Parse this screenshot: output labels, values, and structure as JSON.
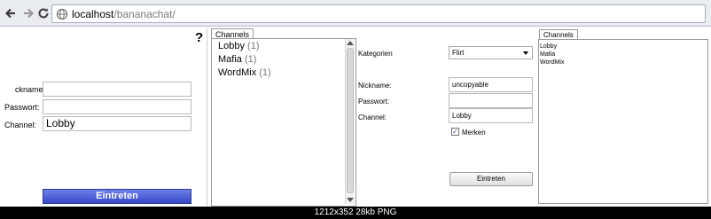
{
  "browser": {
    "url_host": "localhost",
    "url_path": "/bananachat/",
    "icons": [
      "back-icon",
      "forward-icon",
      "globe-icon"
    ]
  },
  "login": {
    "help": "?",
    "nickname_label": "ckname:",
    "password_label": "Passwort:",
    "channel_label": "Channel:",
    "nickname_value": "",
    "password_value": "",
    "channel_value": "Lobby",
    "submit_label": "Eintreten",
    "submit_color": "#3f52d2"
  },
  "channels_panel": {
    "tab_label": "Channels",
    "items": [
      {
        "name": "Lobby",
        "count": "(1)"
      },
      {
        "name": "Mafia",
        "count": "(1)"
      },
      {
        "name": "WordMix",
        "count": "(1)"
      }
    ]
  },
  "form2": {
    "kategorien_label": "Kategorien",
    "kategorien_value": "Flirt",
    "nickname_label": "Nickname:",
    "nickname_value": "uncopyable",
    "password_label": "Passwort:",
    "password_value": "",
    "channel_label": "Channel:",
    "channel_value": "Lobby",
    "remember_label": "Merken",
    "remember_checked": true,
    "submit_label": "Eintreten"
  },
  "channels_panel2": {
    "tab_label": "Channels",
    "items": [
      "Lobby",
      "Mafia",
      "WordMix"
    ]
  },
  "caption": "1212x352 28kb PNG"
}
